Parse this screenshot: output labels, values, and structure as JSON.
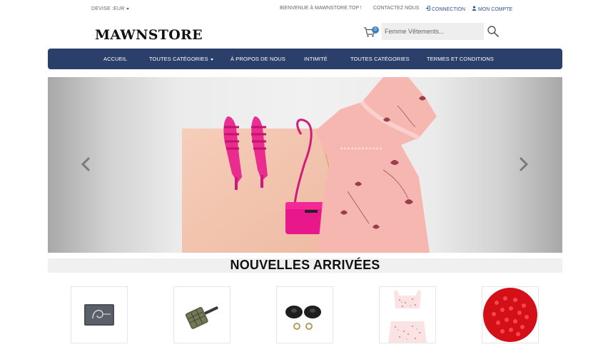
{
  "topbar": {
    "currency_label": "DEVISE :EUR",
    "welcome": "BIENVENUE À MAWNSTORE.TOP !",
    "contact": "CONTACTEZ NOUS",
    "login": "CONNECTION",
    "account": "MON COMPTE"
  },
  "header": {
    "logo": "MAWNSTORE",
    "cart_count": "0",
    "search_placeholder": "Femme Vêtements..."
  },
  "nav": {
    "items": [
      {
        "label": "ACCUEIL"
      },
      {
        "label": "TOUTES CATÉGORIES"
      },
      {
        "label": "À PROPOS DE NOUS"
      },
      {
        "label": "INTIMITÉ"
      },
      {
        "label": "TOUTES CATÉGORIES"
      },
      {
        "label": "TERMES ET CONDITIONS"
      }
    ]
  },
  "slider": {
    "prev_icon": "chevron-left-icon",
    "next_icon": "chevron-right-icon"
  },
  "new_arrivals": {
    "title": "NOUVELLES ARRIVÉES"
  },
  "colors": {
    "nav_bg": "#2b3f6b",
    "link_blue": "#2f5597",
    "badge_blue": "#3d80c5",
    "dress_pink": "#f6b7b1",
    "accent_pink": "#e91e8c"
  }
}
